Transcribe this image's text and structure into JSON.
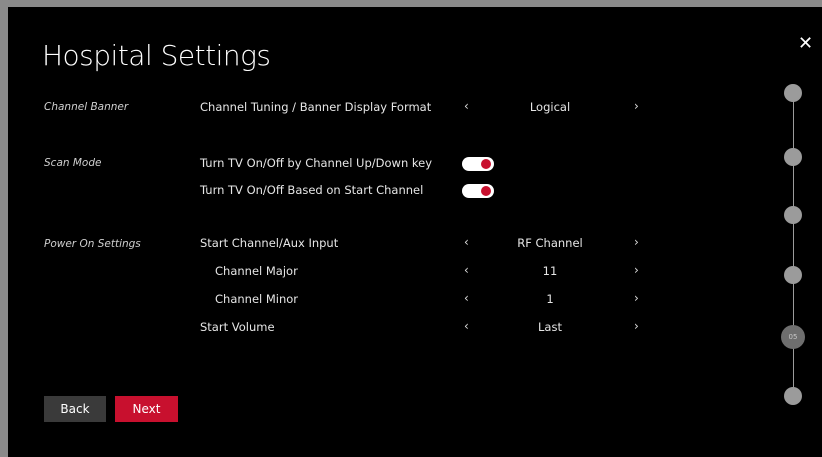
{
  "title": "Hospital Settings",
  "close_glyph": "✕",
  "sections": {
    "channel_banner": "Channel Banner",
    "scan_mode": "Scan Mode",
    "power_on": "Power On Settings"
  },
  "rows": {
    "banner_format": {
      "label": "Channel Tuning / Banner Display Format",
      "value": "Logical"
    },
    "tv_onoff_updown": {
      "label": "Turn TV On/Off by Channel Up/Down key",
      "enabled": true
    },
    "tv_onoff_start": {
      "label": "Turn TV On/Off Based on Start Channel",
      "enabled": true
    },
    "start_channel": {
      "label": "Start Channel/Aux Input",
      "value": "RF Channel"
    },
    "channel_major": {
      "label": "Channel Major",
      "value": "11"
    },
    "channel_minor": {
      "label": "Channel Minor",
      "value": "1"
    },
    "start_volume": {
      "label": "Start Volume",
      "value": "Last"
    }
  },
  "arrows": {
    "left": "‹",
    "right": "›"
  },
  "buttons": {
    "back": "Back",
    "next": "Next"
  },
  "stepper": {
    "current_label": "05",
    "current_index": 5,
    "total": 6
  },
  "colors": {
    "accent": "#c8102e",
    "background": "#000000",
    "step": "#9b9b9b"
  }
}
